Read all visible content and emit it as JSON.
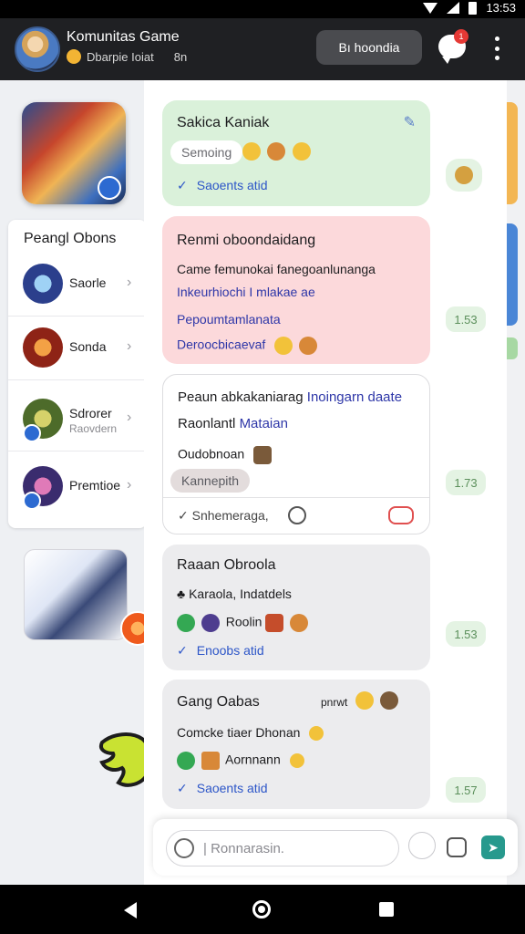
{
  "status_bar": {
    "time": "13:53"
  },
  "header": {
    "title": "Komunitas Game",
    "subtitle": "Dbarpie Ioiat",
    "subtitle_extra": "8n",
    "action_button": "Bı hoondia",
    "notification_count": "1"
  },
  "sidebar": {
    "panel_title": "Peangl Obons",
    "items": [
      {
        "label": "Saorle",
        "sub": ""
      },
      {
        "label": "Sonda",
        "sub": ""
      },
      {
        "label": "Sdrorer",
        "sub": "Raovdern"
      },
      {
        "label": "Premtioe",
        "sub": ""
      }
    ],
    "hero_card_label": "Banner"
  },
  "messages": [
    {
      "title": "Sakica Kaniak",
      "pill": "Semoing",
      "status": "Saoents atid",
      "reaction_chip": ""
    },
    {
      "line1": "Renmi oboondaidang",
      "line2": "Came femunokai fanegoanlunanga",
      "line3": "Inkeurhiochi I mlakae ae",
      "line4": "Pepoumtamlanata",
      "line5": "Deroocbicaevaf",
      "time": "1.53"
    },
    {
      "line1_a": "Peaun abkakaniarag",
      "line1_b": "Inoingarn daate",
      "line2_a": "Raonlantl",
      "line2_b": "Mataian",
      "line3": "Oudobnoan",
      "pill": "Kannepith",
      "footer_text": "Snhemeraga,",
      "time": "1.73"
    },
    {
      "line1": "Raaan Obroola",
      "line2": "Karaola, Indatdels",
      "line3": "Roolin",
      "status": "Enoobs atid",
      "time": "1.53"
    },
    {
      "line1": "Gang Oabas",
      "line1_tag": "pnrwt",
      "line2": "Comcke tiaer Dhonan",
      "line3": "Aornnann",
      "status": "Saoents atid",
      "time": "1.57"
    }
  ],
  "composer": {
    "placeholder": "Ronnarasin."
  },
  "colors": {
    "header_bg": "#1f2023",
    "bubble_green": "#daf1da",
    "bubble_pink": "#fcd9db",
    "bubble_gray": "#ececee",
    "accent_blue": "#2d56c8",
    "send_teal": "#27998d"
  }
}
